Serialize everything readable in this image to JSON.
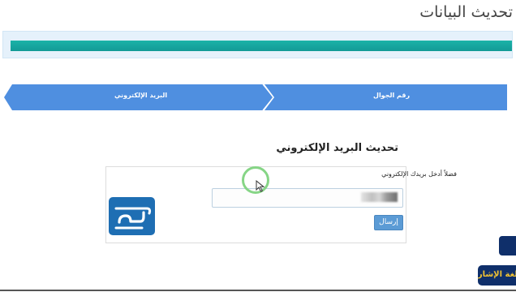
{
  "header": {
    "title": "تحديث البيانات"
  },
  "steps": [
    {
      "label": "رقم الجوال"
    },
    {
      "label": "البريد الإلكتروني"
    }
  ],
  "form": {
    "section_title": "تحديث البريد الإلكتروني",
    "email_label": "فضلاً أدخل بريدك الإلكتروني",
    "submit_label": "إرسال"
  },
  "side": {
    "sign_label": "لغة الإشارة"
  },
  "colors": {
    "step_blue": "#4f8fe0",
    "progress_teal": "#15a89f",
    "navy": "#0f2f6a",
    "button_blue": "#5b9bd5"
  },
  "icons": {
    "logo": "site-logo",
    "cursor": "mouse-cursor-icon"
  }
}
